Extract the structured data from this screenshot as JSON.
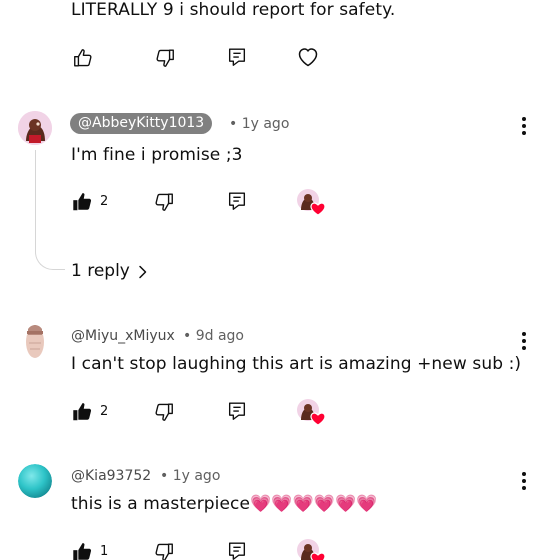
{
  "comments": [
    {
      "text": "LITERALLY 9 i should report for safety.",
      "likes": ""
    },
    {
      "author": "@AbbeyKitty1013",
      "time": "• 1y ago",
      "text": "I'm fine i promise ;3",
      "likes": "2",
      "replies_link": "1 reply"
    },
    {
      "author": "@Miyu_xMiyux",
      "time": "• 9d ago",
      "text": "I can't stop laughing this art is amazing +new sub :)",
      "likes": "2"
    },
    {
      "author": "@Kia93752",
      "time": "• 1y ago",
      "text": "this is a masterpiece💗💗💗💗💗💗",
      "likes": "1"
    }
  ],
  "icons": {
    "like": "thumbs-up-icon",
    "dislike": "thumbs-down-icon",
    "reply": "reply-icon",
    "heart": "heart-icon",
    "creator_heart": "creator-heart-avatar-icon",
    "menu": "kebab-menu-icon",
    "chevron": "chevron-right-icon"
  },
  "colors": {
    "text": "#0f0f0f",
    "meta": "#606060",
    "author_pill": "#808080",
    "heart_red": "#ff0033",
    "kia_avatar": "#2ec4c8"
  }
}
